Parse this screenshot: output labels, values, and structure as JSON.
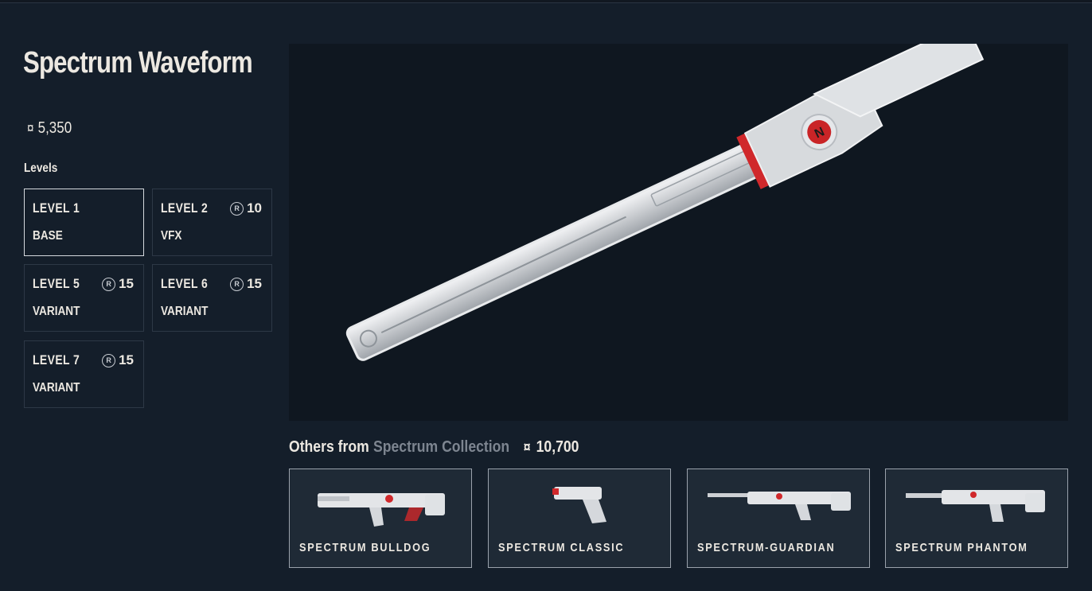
{
  "skin": {
    "title": "Spectrum Waveform",
    "price": "5,350",
    "price_icon": "valorant-points-icon"
  },
  "levels_label": "Levels",
  "levels": [
    {
      "name": "LEVEL 1",
      "type": "BASE",
      "cost": ""
    },
    {
      "name": "LEVEL 2",
      "type": "VFX",
      "cost": "10"
    },
    {
      "name": "LEVEL 5",
      "type": "VARIANT",
      "cost": "15"
    },
    {
      "name": "LEVEL 6",
      "type": "VARIANT",
      "cost": "15"
    },
    {
      "name": "LEVEL 7",
      "type": "VARIANT",
      "cost": "15"
    }
  ],
  "radianite_icon": "radianite-icon",
  "others": {
    "prefix": "Others from",
    "collection": "Spectrum Collection",
    "total": "10,700"
  },
  "collection_items": [
    {
      "name": "SPECTRUM BULLDOG"
    },
    {
      "name": "SPECTRUM CLASSIC"
    },
    {
      "name": "SPECTRUM-GUARDIAN"
    },
    {
      "name": "SPECTRUM PHANTOM"
    }
  ],
  "colors": {
    "background": "#141e2a",
    "text": "#ece8e1",
    "accent_red": "#d0282b",
    "muted": "#7d8590"
  }
}
